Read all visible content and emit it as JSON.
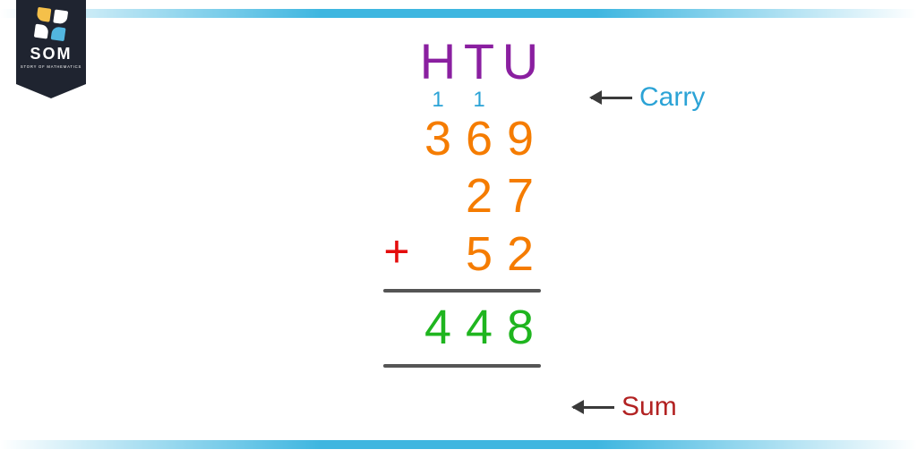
{
  "logo": {
    "name": "SOM",
    "sub": "STORY OF MATHEMATICS"
  },
  "header": {
    "H": "H",
    "T": "T",
    "U": "U"
  },
  "carry": {
    "H": "1",
    "T": "1"
  },
  "addends": [
    {
      "H": "3",
      "T": "6",
      "U": "9"
    },
    {
      "H": "",
      "T": "2",
      "U": "7"
    },
    {
      "H": "",
      "T": "5",
      "U": "2"
    }
  ],
  "plus": "+",
  "sum": {
    "H": "4",
    "T": "4",
    "U": "8"
  },
  "labels": {
    "carry": "Carry",
    "sum": "Sum"
  }
}
